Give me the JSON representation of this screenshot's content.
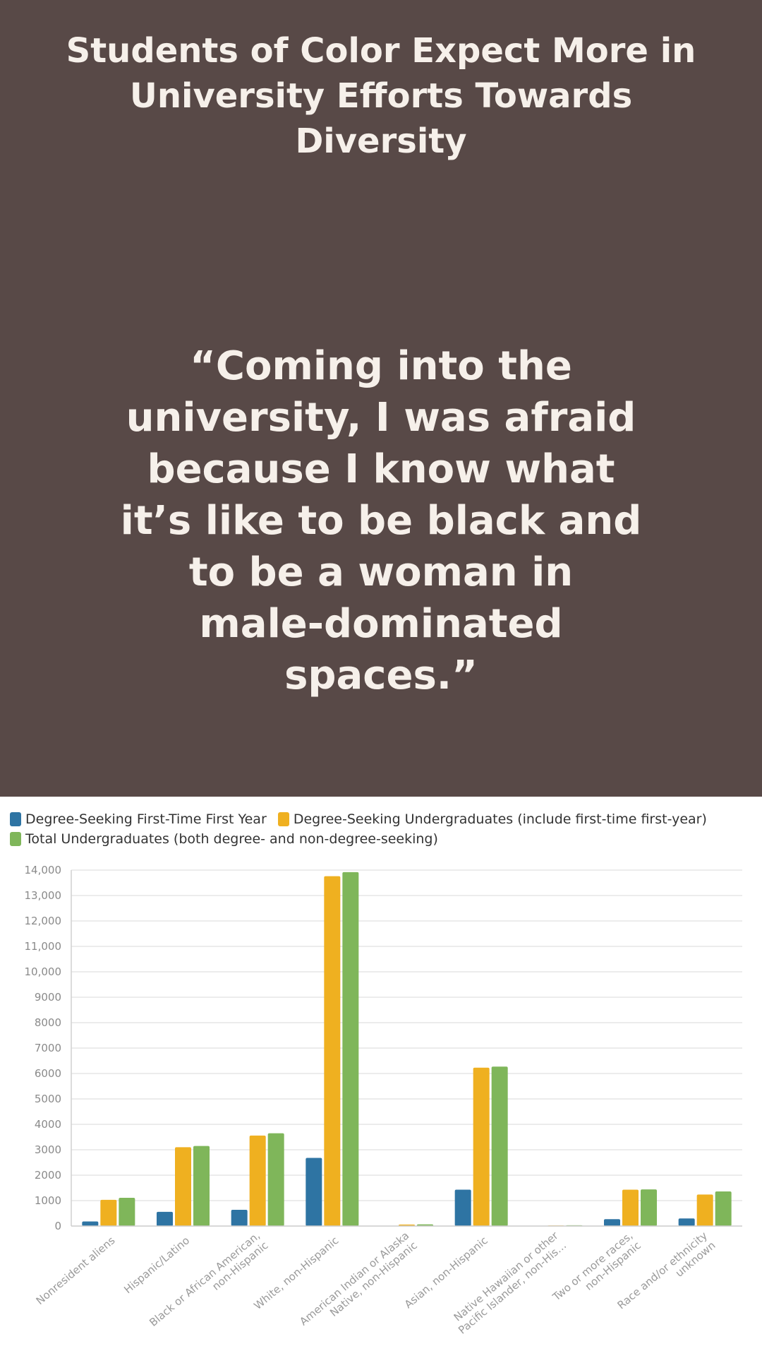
{
  "header": {
    "title_line1": "Students of Color Expect More in",
    "title_line2": "University Efforts Towards Diversity"
  },
  "quote": {
    "lines": [
      "“Coming into the",
      "university, I was afraid",
      "because I know what",
      "it’s like to be black and",
      "to be a woman in",
      "male-dominated spaces.”"
    ]
  },
  "colors": {
    "top_background": "#584947",
    "text_light": "#f6f0ea",
    "series_blue": "#2e74a3",
    "series_yellow": "#efb020",
    "series_green": "#7fb65a"
  },
  "chart_data": {
    "type": "bar",
    "title": "",
    "xlabel": "",
    "ylabel": "",
    "ylim": [
      0,
      14000
    ],
    "grid": true,
    "legend_position": "top-left",
    "y_ticks": [
      "0",
      "1000",
      "2000",
      "3000",
      "4000",
      "5000",
      "6000",
      "7000",
      "8000",
      "9000",
      "10,000",
      "11,000",
      "12,000",
      "13,000",
      "14,000"
    ],
    "categories": [
      [
        "Nonresident aliens"
      ],
      [
        "Hispanic/Latino"
      ],
      [
        "Black or African American,",
        "non-Hispanic"
      ],
      [
        "White, non-Hispanic"
      ],
      [
        "American Indian or Alaska",
        "Native, non-Hispanic"
      ],
      [
        "Asian, non-Hispanic"
      ],
      [
        "Native Hawaiian or other",
        "Pacific Islander, non-His…"
      ],
      [
        "Two or more races,",
        "non-Hispanic"
      ],
      [
        "Race and/or ethnicity",
        "unknown"
      ]
    ],
    "series": [
      {
        "name": "Degree-Seeking First-Time First Year",
        "color": "#2e74a3",
        "values": [
          180,
          560,
          640,
          2680,
          15,
          1430,
          5,
          270,
          300
        ]
      },
      {
        "name": "Degree-Seeking Undergraduates (include first-time first-year)",
        "color": "#efb020",
        "values": [
          1030,
          3100,
          3560,
          13760,
          60,
          6230,
          25,
          1430,
          1240
        ]
      },
      {
        "name": "Total Undergraduates (both degree- and non-degree-seeking)",
        "color": "#7fb65a",
        "values": [
          1110,
          3150,
          3650,
          13920,
          65,
          6270,
          30,
          1440,
          1360
        ]
      }
    ]
  }
}
